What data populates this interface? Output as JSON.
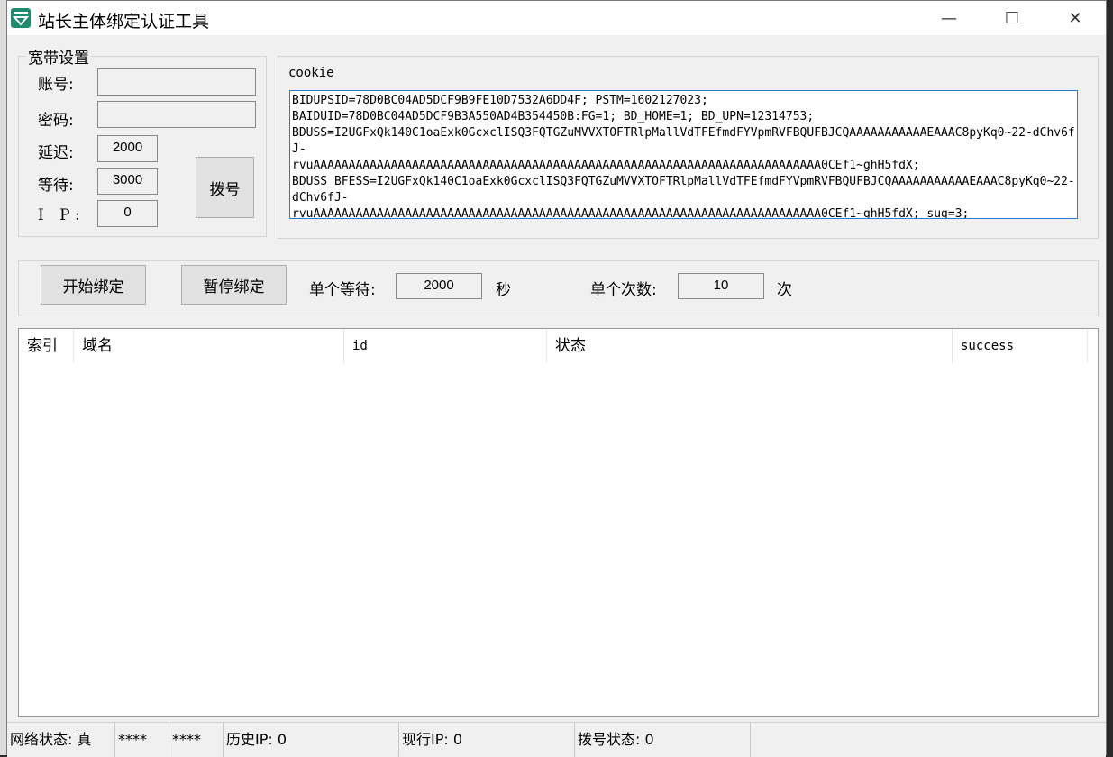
{
  "window": {
    "title": "站长主体绑定认证工具",
    "min_glyph": "—",
    "max_glyph": "☐",
    "close_glyph": "✕"
  },
  "broadband": {
    "group_title": "宽带设置",
    "account_label": "账号:",
    "account_value": "",
    "password_label": "密码:",
    "password_value": "",
    "delay_label": "延迟:",
    "delay_value": "2000",
    "wait_label": "等待:",
    "wait_value": "3000",
    "ip_label": "I P:",
    "ip_value": "0",
    "dial_button": "拨号"
  },
  "cookie": {
    "label": "cookie",
    "value": "BIDUPSID=78D0BC04AD5DCF9B9FE10D7532A6DD4F; PSTM=1602127023;\nBAIDUID=78D0BC04AD5DCF9B3A550AD4B354450B:FG=1; BD_HOME=1; BD_UPN=12314753;\nBDUSS=I2UGFxQk140C1oaExk0GcxclISQ3FQTGZuMVVXTOFTRlpMallVdTFEfmdFYVpmRVFBQUFBJCQAAAAAAAAAAAEAAAC8pyKq0~22-dChv6fJ-\nrvuAAAAAAAAAAAAAAAAAAAAAAAAAAAAAAAAAAAAAAAAAAAAAAAAAAAAAAAAAAAAAAAAAAAAAAAA0CEf1~ghH5fdX;\nBDUSS_BFESS=I2UGFxQk140C1oaExk0GcxclISQ3FQTGZuMVVXTOFTRlpMallVdTFEfmdFYVpmRVFBQUFBJCQAAAAAAAAAAAEAAAC8pyKq0~22-dChv6fJ-\nrvuAAAAAAAAAAAAAAAAAAAAAAAAAAAAAAAAAAAAAAAAAAAAAAAAAAAAAAAAAAAAAAAAAAAAAAAA0CEf1~ghH5fdX; sug=3;"
  },
  "controls": {
    "start_button": "开始绑定",
    "pause_button": "暂停绑定",
    "single_wait_label": "单个等待:",
    "single_wait_value": "2000",
    "single_wait_unit": "秒",
    "single_count_label": "单个次数:",
    "single_count_value": "10",
    "single_count_unit": "次"
  },
  "table": {
    "columns": [
      "索引",
      "域名",
      "id",
      "状态",
      "success"
    ]
  },
  "statusbar": {
    "network_status": "网络状态: 真",
    "mask1": "****",
    "mask2": "****",
    "history_ip": "历史IP: 0",
    "current_ip": "现行IP: 0",
    "dial_status": "拨号状态: 0"
  },
  "colors": {
    "accent": "#2b7ad6",
    "window_bg": "#f0f0f0",
    "icon": "#1e8a6e"
  }
}
